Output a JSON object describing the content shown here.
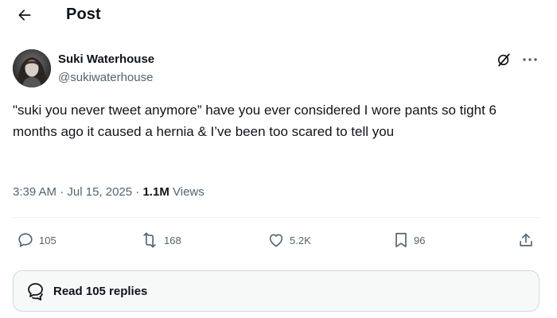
{
  "header": {
    "title": "Post",
    "back_icon": "arrow-left-icon"
  },
  "author": {
    "name": "Suki Waterhouse",
    "handle": "@sukiwaterhouse",
    "avatar_icon": "profile-photo"
  },
  "post": {
    "text": "\"suki you never tweet anymore” have you ever considered I wore pants so tight 6 months ago it caused a hernia & I’ve been too scared to tell you",
    "time": "3:39 AM",
    "separator": "·",
    "date": "Jul 15, 2025",
    "views_count": "1.1M",
    "views_label": "Views"
  },
  "actions": {
    "reply_count": "105",
    "retweet_count": "168",
    "like_count": "5.2K",
    "bookmark_count": "96"
  },
  "replies": {
    "label": "Read 105 replies"
  },
  "colors": {
    "text_primary": "#0f1419",
    "text_secondary": "#536471",
    "border": "#cfd9de",
    "divider": "#eff3f4",
    "button_bg": "#f7f9f9"
  }
}
